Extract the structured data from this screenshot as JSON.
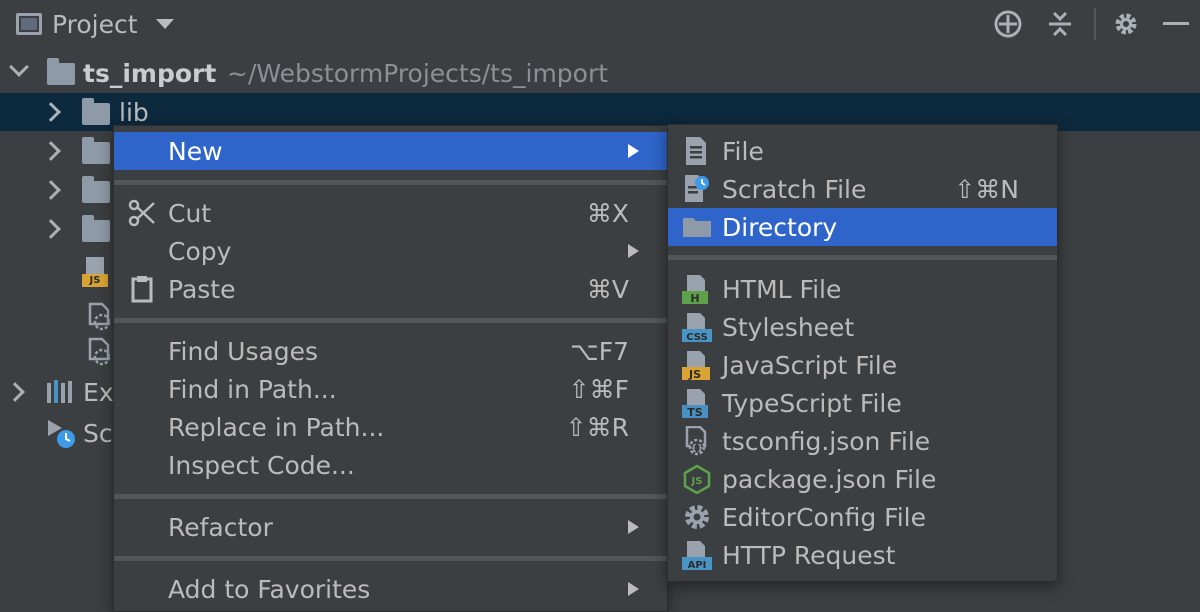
{
  "toolbar": {
    "title": "Project",
    "icons": [
      "window-icon",
      "crosshair-icon",
      "collapse-icon",
      "gear-icon",
      "minimize-icon"
    ]
  },
  "tree": {
    "root": {
      "name": "ts_import",
      "path": "~/WebstormProjects/ts_import"
    },
    "selected": "lib",
    "partial_items": [
      "Ex",
      "Sc"
    ]
  },
  "menu": {
    "items": [
      {
        "label": "New",
        "shortcut": "",
        "submenu": true,
        "active": true
      },
      {
        "label": "Cut",
        "shortcut": "⌘X",
        "icon": "scissors-icon"
      },
      {
        "label": "Copy",
        "shortcut": "",
        "submenu": true
      },
      {
        "label": "Paste",
        "shortcut": "⌘V",
        "icon": "clipboard-icon"
      },
      {
        "label": "Find Usages",
        "shortcut": "⌥F7"
      },
      {
        "label": "Find in Path...",
        "shortcut": "⇧⌘F"
      },
      {
        "label": "Replace in Path...",
        "shortcut": "⇧⌘R"
      },
      {
        "label": "Inspect Code..."
      },
      {
        "label": "Refactor",
        "submenu": true
      },
      {
        "label": "Add to Favorites",
        "submenu": true
      }
    ]
  },
  "submenu": {
    "items": [
      {
        "label": "File",
        "icon": "file-icon"
      },
      {
        "label": "Scratch File",
        "shortcut": "⇧⌘N",
        "icon": "scratch-file-icon"
      },
      {
        "label": "Directory",
        "icon": "folder-icon",
        "active": true
      },
      {
        "label": "HTML File",
        "icon": "html-file-icon",
        "badge": "H"
      },
      {
        "label": "Stylesheet",
        "icon": "css-file-icon",
        "badge": "CSS"
      },
      {
        "label": "JavaScript File",
        "icon": "js-file-icon",
        "badge": "JS"
      },
      {
        "label": "TypeScript File",
        "icon": "ts-file-icon",
        "badge": "TS"
      },
      {
        "label": "tsconfig.json File",
        "icon": "tsconfig-file-icon"
      },
      {
        "label": "package.json File",
        "icon": "nodejs-icon"
      },
      {
        "label": "EditorConfig File",
        "icon": "gear-icon"
      },
      {
        "label": "HTTP Request",
        "icon": "api-file-icon",
        "badge": "API"
      }
    ]
  },
  "colors": {
    "background": "#3c3f41",
    "selection": "#2f65ca",
    "tree_selection": "#0d293e",
    "js_badge": "#d9a434",
    "css_badge": "#4a94c5",
    "html_badge": "#5ea14b",
    "ts_badge": "#4a8fc2",
    "api_badge": "#4a94c5"
  }
}
